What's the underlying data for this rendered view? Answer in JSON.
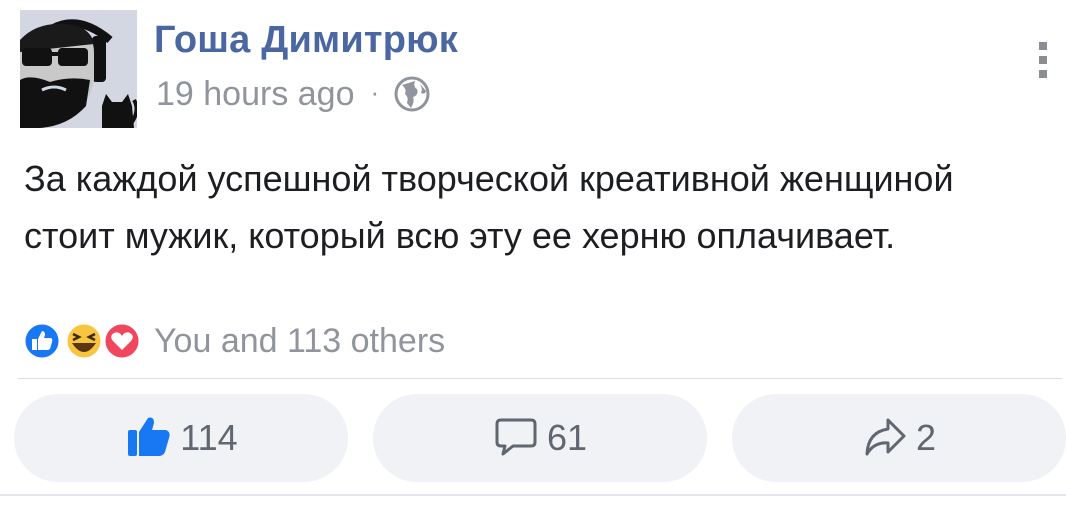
{
  "post": {
    "author_name": "Гоша Димитрюк",
    "timestamp": "19 hours ago",
    "separator": "·",
    "privacy_icon": "globe-icon",
    "text": "За каждой успешной творческой креативной женщиной стоит мужик, который всю эту ее херню оплачивает.",
    "menu_icon": "kebab-menu-icon"
  },
  "reactions": {
    "icons": [
      "like-icon",
      "haha-icon",
      "love-icon"
    ],
    "summary": "You and 113 others"
  },
  "actions": {
    "like": {
      "icon": "thumbs-up-icon",
      "count": "114"
    },
    "comment": {
      "icon": "comment-bubble-icon",
      "count": "61"
    },
    "share": {
      "icon": "share-arrow-icon",
      "count": "2"
    }
  },
  "colors": {
    "author": "#4b67a1",
    "meta": "#90949c",
    "like_blue": "#1877f2",
    "haha_yellow": "#f7c540",
    "love_red": "#f0465e",
    "button_bg": "#f0f2f5"
  }
}
